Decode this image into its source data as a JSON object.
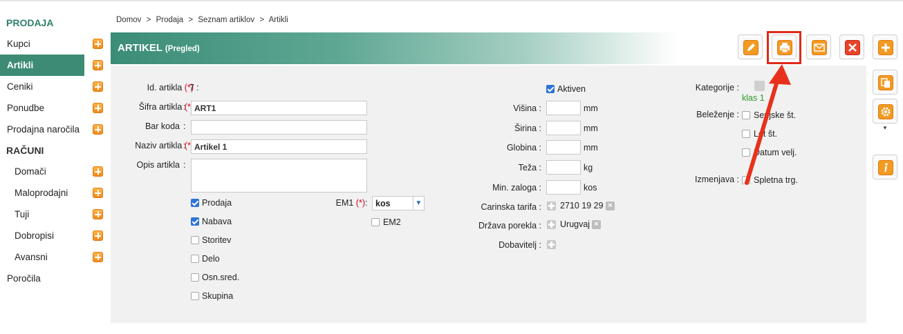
{
  "sidebar": {
    "sections": [
      {
        "title": "PRODAJA",
        "items": [
          {
            "label": "Kupci",
            "active": false,
            "has_add": true
          },
          {
            "label": "Artikli",
            "active": true,
            "has_add": true
          },
          {
            "label": "Ceniki",
            "active": false,
            "has_add": true
          },
          {
            "label": "Ponudbe",
            "active": false,
            "has_add": true
          },
          {
            "label": "Prodajna naročila",
            "active": false,
            "has_add": true
          }
        ]
      },
      {
        "title": "RAČUNI",
        "items": [
          {
            "label": "Domači",
            "has_add": true
          },
          {
            "label": "Maloprodajni",
            "has_add": true
          },
          {
            "label": "Tuji",
            "has_add": true
          },
          {
            "label": "Dobropisi",
            "has_add": true
          },
          {
            "label": "Avansni",
            "has_add": true
          }
        ]
      }
    ],
    "footer_item": "Poročila"
  },
  "breadcrumb": [
    "Domov",
    ">",
    "Prodaja",
    ">",
    "Seznam artiklov",
    ">",
    "Artikli"
  ],
  "header": {
    "title": "ARTIKEL",
    "mode": "(Pregled)"
  },
  "toolbar": {
    "icons": [
      "edit-icon",
      "print-icon",
      "email-icon",
      "delete-icon",
      "add-icon",
      "copy-icon",
      "settings-icon",
      "info-icon"
    ],
    "highlighted": "print-icon",
    "caret": "▾",
    "colors": {
      "orange": "#f08a18",
      "red": "#d8301a",
      "highlight": "#e0291a",
      "accent": "#3d8b74"
    }
  },
  "form": {
    "required_mark": "(*)",
    "id_label": "Id. artikla",
    "id_value": "7",
    "sifra_label": "Šifra artikla",
    "sifra_value": "ART1",
    "barkoda_label": "Bar koda",
    "barkoda_value": "",
    "naziv_label": "Naziv artikla",
    "naziv_value": "Artikel 1",
    "opis_label": "Opis artikla",
    "opis_value": "",
    "checks": [
      {
        "label": "Prodaja",
        "checked": true
      },
      {
        "label": "Nabava",
        "checked": true
      },
      {
        "label": "Storitev",
        "checked": false
      },
      {
        "label": "Delo",
        "checked": false
      },
      {
        "label": "Osn.sred.",
        "checked": false
      },
      {
        "label": "Skupina",
        "checked": false
      }
    ],
    "em1_label": "EM1",
    "em1_value": "kos",
    "em2_label": "EM2",
    "em2_checked": false,
    "aktiven_label": "Aktiven",
    "aktiven_checked": true,
    "dims": [
      {
        "label": "Višina",
        "unit": "mm"
      },
      {
        "label": "Širina",
        "unit": "mm"
      },
      {
        "label": "Globina",
        "unit": "mm"
      },
      {
        "label": "Teža",
        "unit": "kg"
      },
      {
        "label": "Min. zaloga",
        "unit": "kos"
      }
    ],
    "carinska_label": "Carinska tarifa",
    "carinska_value": "2710 19 29",
    "drzava_label": "Država porekla",
    "drzava_value": "Urugvaj",
    "dobavitelj_label": "Dobavitelj",
    "kategorije_label": "Kategorije",
    "kategorije_value": "klas 1",
    "belezenje_label": "Beleženje",
    "belezenje_items": [
      "Serijske št.",
      "Lot št.",
      "Datum velj."
    ],
    "izmenjava_label": "Izmenjava",
    "izmenjava_items": [
      "Spletna trg."
    ],
    "colon": ":"
  }
}
